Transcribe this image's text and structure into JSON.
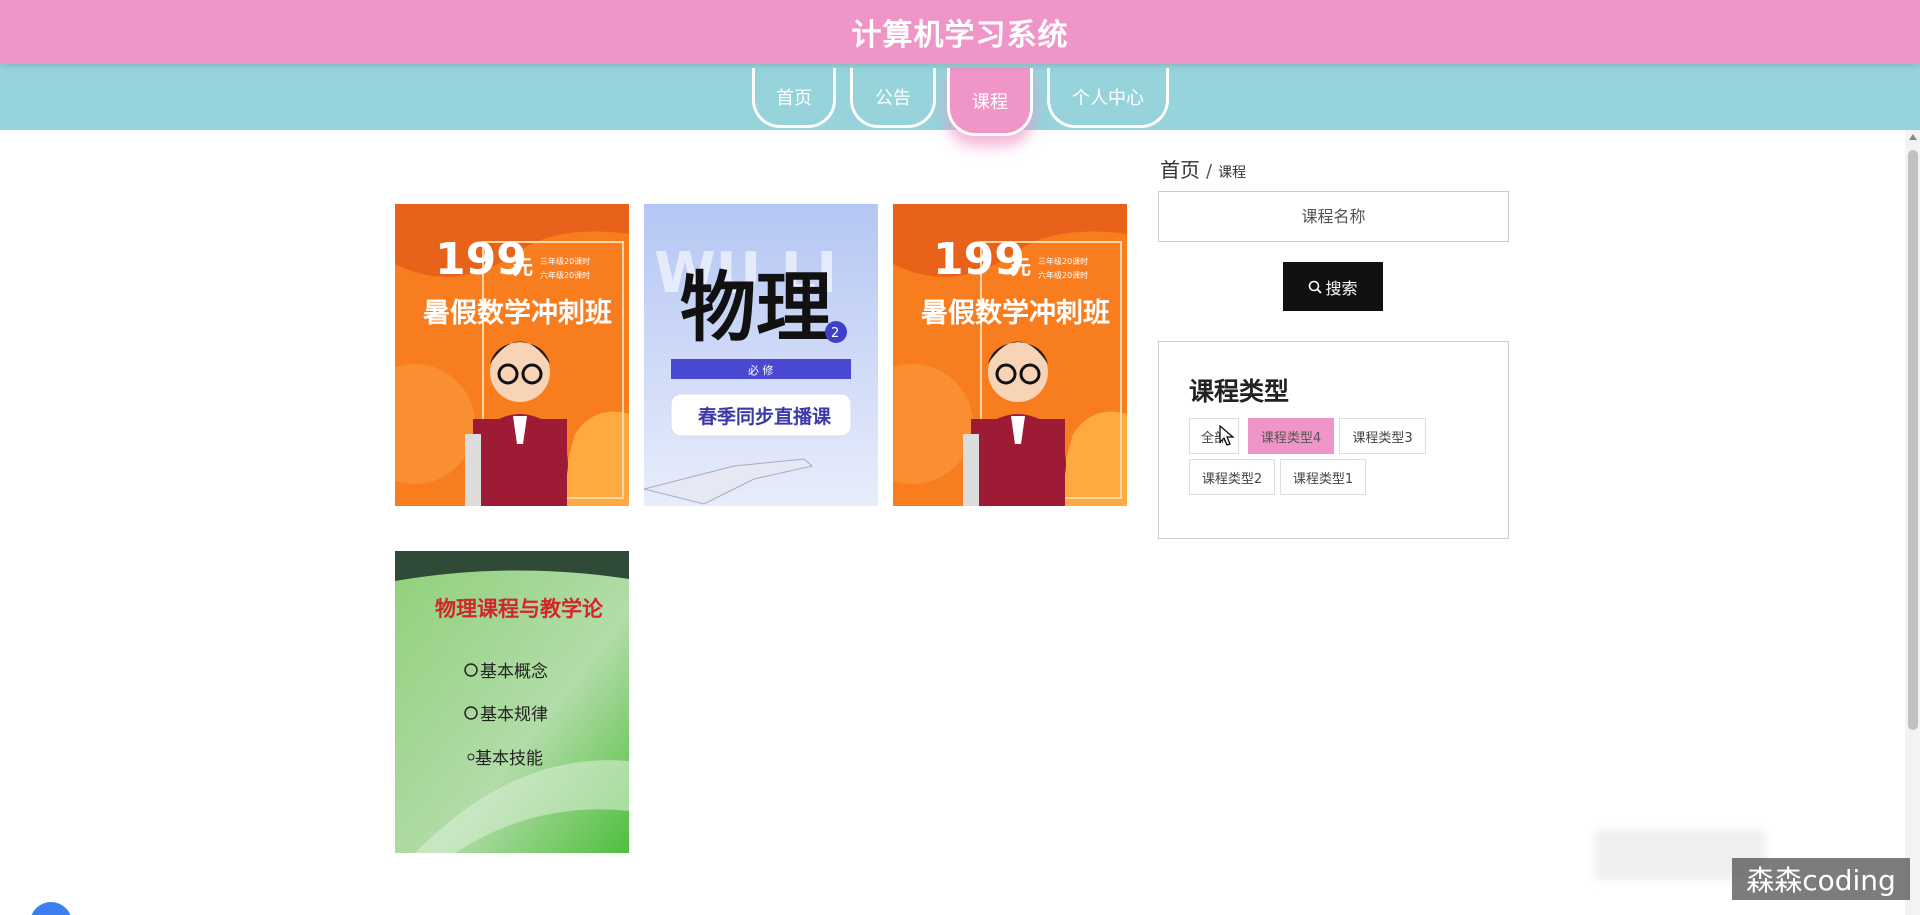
{
  "header": {
    "title": "计算机学习系统"
  },
  "nav": {
    "items": [
      {
        "label": "首页"
      },
      {
        "label": "公告"
      },
      {
        "label": "课程"
      },
      {
        "label": "个人中心"
      }
    ],
    "active": "课程"
  },
  "courses": [
    {
      "image_text": {
        "price": "199",
        "unit": "元",
        "title": "暑假数学冲刺班",
        "note1": "三年级20课时",
        "note2": "六年级20课时"
      }
    },
    {
      "image_text": {
        "bg_text": "WU LI",
        "title": "物理",
        "badge": "2",
        "strip": "必 修",
        "subtitle": "春季同步直播课"
      }
    },
    {
      "image_text": {
        "price": "199",
        "unit": "元",
        "title": "暑假数学冲刺班",
        "note1": "三年级20课时",
        "note2": "六年级20课时"
      }
    },
    {
      "image_text": {
        "title": "物理课程与教学论",
        "items": [
          "基本概念",
          "基本规律",
          "基本技能"
        ]
      }
    }
  ],
  "breadcrumb": {
    "home": "首页",
    "separator": "/",
    "current": "课程"
  },
  "search": {
    "placeholder": "课程名称",
    "button_label": "搜索",
    "button_icon": "search-icon"
  },
  "course_types": {
    "title": "课程类型",
    "tags": [
      "全部",
      "课程类型4",
      "课程类型3",
      "课程类型2",
      "课程类型1"
    ],
    "active": "课程类型4"
  },
  "watermark": "森森coding",
  "colors": {
    "header": "#f095c7",
    "nav": "#96d3db",
    "accent": "#f095c7",
    "button": "#111111"
  }
}
